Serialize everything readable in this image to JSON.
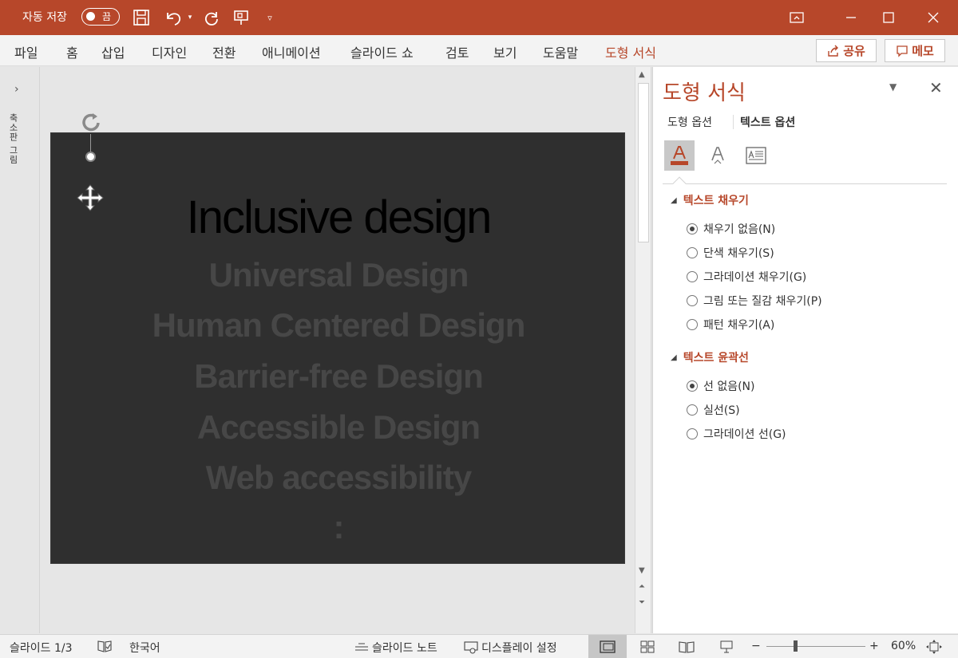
{
  "titlebar": {
    "autosave_label": "자동 저장",
    "autosave_state": "끔",
    "colors": {
      "bar": "#b7472a"
    },
    "quick_access_icons": [
      "save-icon",
      "undo-icon",
      "redo-icon",
      "present-icon",
      "customize-icon"
    ],
    "window_buttons": [
      "ribbon-display-icon",
      "minimize-icon",
      "maximize-icon",
      "close-icon"
    ]
  },
  "menu": {
    "items": [
      "파일",
      "홈",
      "삽입",
      "디자인",
      "전환",
      "애니메이션",
      "슬라이드 쇼",
      "검토",
      "보기",
      "도움말",
      "도형 서식"
    ],
    "active": "도형 서식",
    "share_label": "공유",
    "comment_label": "메모"
  },
  "thumbnails": {
    "label": "축소판 그림",
    "expand_icon": "chevron-right-icon"
  },
  "slide": {
    "heading": "Inclusive design",
    "lines": [
      "Universal Design",
      "Human Centered Design",
      "Barrier-free Design",
      "Accessible Design",
      "Web accessibility",
      ":"
    ]
  },
  "pane": {
    "title": "도형 서식",
    "tabs": [
      "도형 옵션",
      "텍스트 옵션"
    ],
    "active_tab": "텍스트 옵션",
    "icons": [
      "text-fill-outline-icon",
      "text-effects-icon",
      "textbox-icon"
    ],
    "text_fill": {
      "title": "텍스트 채우기",
      "options": [
        "채우기 없음(N)",
        "단색 채우기(S)",
        "그라데이션 채우기(G)",
        "그림 또는 질감 채우기(P)",
        "패턴 채우기(A)"
      ],
      "selected": "채우기 없음(N)"
    },
    "text_outline": {
      "title": "텍스트 윤곽선",
      "options": [
        "선 없음(N)",
        "실선(S)",
        "그라데이션 선(G)"
      ],
      "selected": "선 없음(N)"
    }
  },
  "status": {
    "slide_counter": "슬라이드 1/3",
    "language": "한국어",
    "notes_label": "슬라이드 노트",
    "display_label": "디스플레이 설정",
    "zoom": "60%",
    "zoom_fraction": 0.6
  }
}
